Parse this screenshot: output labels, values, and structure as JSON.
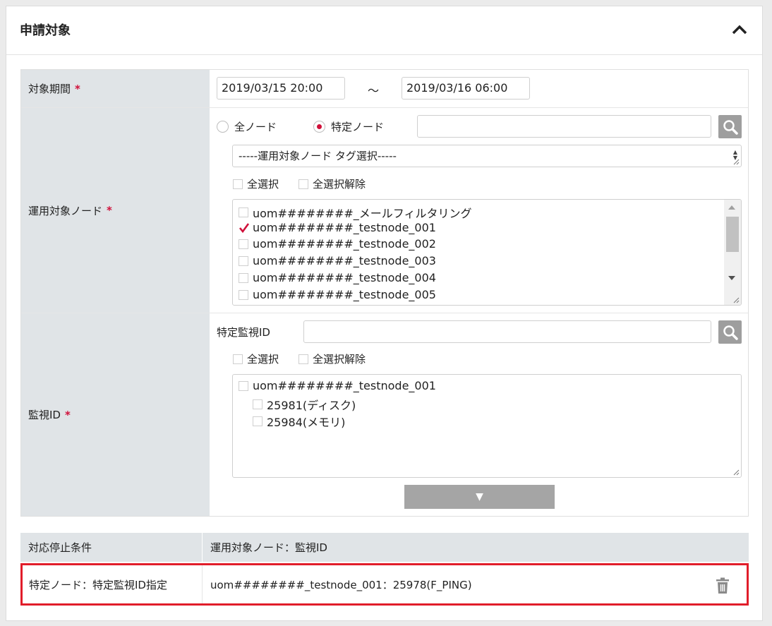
{
  "panel": {
    "title": "申請対象"
  },
  "period": {
    "label": "対象期間",
    "required_mark": "*",
    "start": "2019/03/15 20:00",
    "separator": "～",
    "end": "2019/03/16 06:00"
  },
  "nodes": {
    "label": "運用対象ノード",
    "required_mark": "*",
    "radio_all": "全ノード",
    "radio_specific": "特定ノード",
    "selected_radio": "特定ノード",
    "search_value": "",
    "tag_select": "-----運用対象ノード タグ選択-----",
    "select_all": "全選択",
    "deselect_all": "全選択解除",
    "items": [
      {
        "name": "uom########_メールフィルタリング",
        "checked": false
      },
      {
        "name": "uom########_testnode_001",
        "checked": true
      },
      {
        "name": "uom########_testnode_002",
        "checked": false
      },
      {
        "name": "uom########_testnode_003",
        "checked": false
      },
      {
        "name": "uom########_testnode_004",
        "checked": false
      },
      {
        "name": "uom########_testnode_005",
        "checked": false
      }
    ]
  },
  "monitor": {
    "label": "監視ID",
    "required_mark": "*",
    "search_label": "特定監視ID",
    "search_value": "",
    "select_all": "全選択",
    "deselect_all": "全選択解除",
    "tree": {
      "node": "uom########_testnode_001",
      "children": [
        "25981(ディスク)",
        "25984(メモリ)"
      ]
    },
    "expand_button": "▼"
  },
  "result": {
    "headers": [
      "対応停止条件",
      "運用対象ノード：監視ID"
    ],
    "rows": [
      {
        "condition": "特定ノード：特定監視ID指定",
        "target": "uom########_testnode_001：25978(F_PING)"
      }
    ]
  },
  "colors": {
    "accent": "#d0103a",
    "highlight_border": "#e11d2a",
    "label_bg": "#e0e4e7",
    "button_gray": "#9e9e9e"
  }
}
